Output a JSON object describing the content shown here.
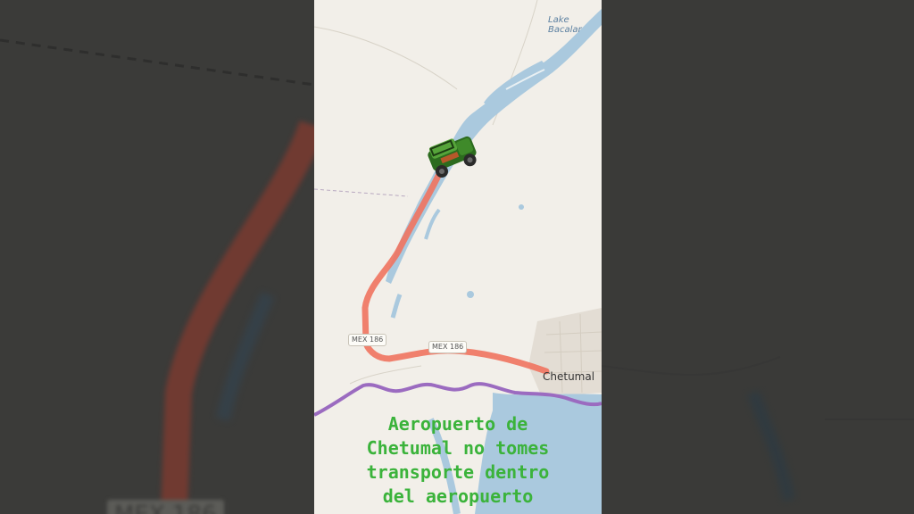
{
  "map": {
    "lake_label": "Lake Bacalar",
    "city_label": "Chetumal",
    "road_shields": [
      "MEX 186",
      "MEX 186"
    ],
    "route_color": "#f0735f",
    "border_color": "#9b6bc0",
    "water_color": "#aac9de",
    "land_color": "#f2efe9",
    "vehicle_icon": "jeep-icon"
  },
  "caption": {
    "lines": [
      "Aeropuerto de",
      "Chetumal no tomes",
      "transporte dentro",
      "del aeropuerto"
    ],
    "color": "#3bb33b"
  },
  "background": {
    "label": "MEX 186"
  }
}
